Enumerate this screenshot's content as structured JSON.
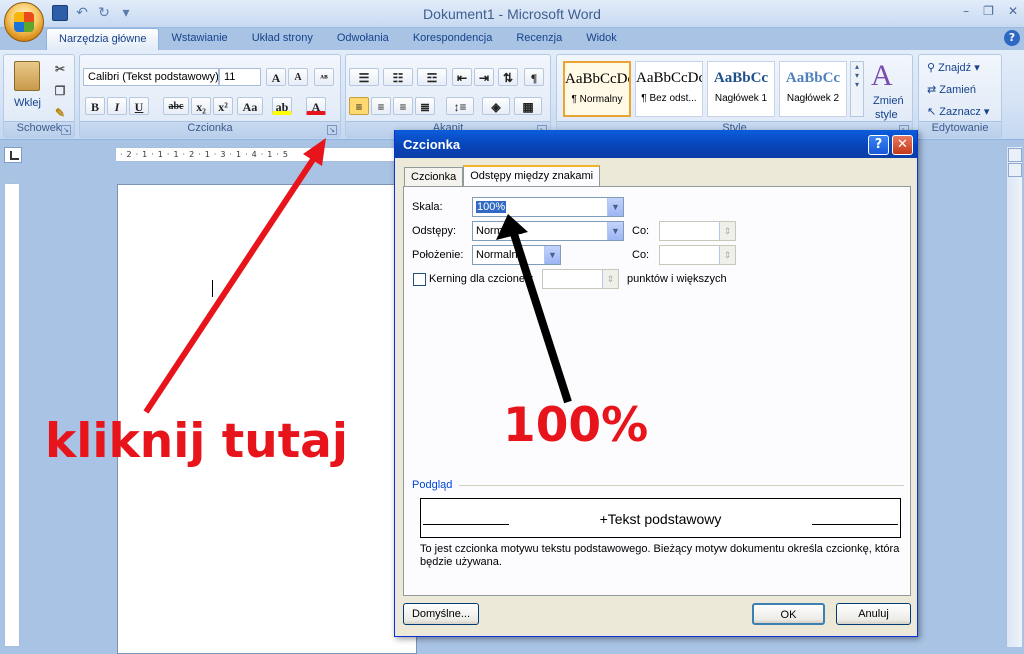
{
  "window": {
    "title": "Dokument1 - Microsoft Word",
    "minimize": "–",
    "restore": "❐",
    "close": "✕"
  },
  "qat": {
    "undo": "↶",
    "redo": "↻",
    "more": "▾"
  },
  "tabs": [
    {
      "label": "Narzędzia główne",
      "active": true
    },
    {
      "label": "Wstawianie"
    },
    {
      "label": "Układ strony"
    },
    {
      "label": "Odwołania"
    },
    {
      "label": "Korespondencja"
    },
    {
      "label": "Recenzja"
    },
    {
      "label": "Widok"
    }
  ],
  "ribbon": {
    "clipboard": {
      "paste_label": "Wklej",
      "group_label": "Schowek"
    },
    "font": {
      "font_name": "Calibri (Tekst podstawowy)",
      "font_size": "11",
      "group_label": "Czcionka",
      "bold": "B",
      "italic": "I",
      "underline": "U",
      "strike": "abc",
      "subscript": "x₂",
      "superscript": "x²",
      "change_case": "Aa"
    },
    "paragraph": {
      "group_label": "Akapit"
    },
    "styles": {
      "group_label": "Style",
      "items": [
        {
          "sample": "AaBbCcDc",
          "name": "¶ Normalny",
          "selected": true
        },
        {
          "sample": "AaBbCcDc",
          "name": "¶ Bez odst..."
        },
        {
          "sample": "AaBbCc",
          "name": "Nagłówek 1"
        },
        {
          "sample": "AaBbCc",
          "name": "Nagłówek 2"
        }
      ],
      "change_styles_label_1": "Zmień",
      "change_styles_label_2": "style"
    },
    "editing": {
      "group_label": "Edytowanie",
      "find": "Znajdź",
      "replace": "Zamień",
      "select": "Zaznacz"
    }
  },
  "ruler": {
    "marks": "·2·1·1·1·2·1·3·1·4·1·5"
  },
  "dialog": {
    "title": "Czcionka",
    "help": "?",
    "close": "✕",
    "tabs": [
      {
        "label": "Czcionka"
      },
      {
        "label": "Odstępy między znakami",
        "active": true
      }
    ],
    "scale_label": "Skala:",
    "scale_value": "100%",
    "spacing_label": "Odstępy:",
    "spacing_value": "Normalne",
    "spacing_by_label": "Co:",
    "position_label": "Położenie:",
    "position_value": "Normalne",
    "position_by_label": "Co:",
    "kerning_label": "Kerning dla czcionek:",
    "kerning_suffix": "punktów i większych",
    "preview_label": "Podgląd",
    "preview_text": "+Tekst podstawowy",
    "description": "To jest czcionka motywu tekstu podstawowego. Bieżący motyw dokumentu określa czcionkę, która będzie używana.",
    "default_button": "Domyślne...",
    "ok_button": "OK",
    "cancel_button": "Anuluj"
  },
  "annotations": {
    "click_here": "kliknij tutaj",
    "percent": "100%"
  },
  "colors": {
    "annotation_red": "#e8141b",
    "annotation_black": "#000000",
    "dialog_title_blue": "#0a5ddc"
  }
}
